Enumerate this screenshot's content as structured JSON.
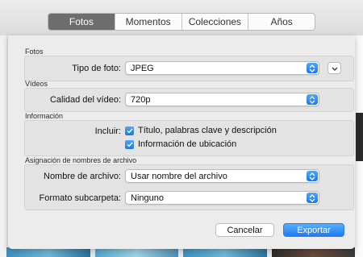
{
  "toolbar": {
    "tabs": [
      {
        "label": "Fotos",
        "active": true
      },
      {
        "label": "Momentos",
        "active": false
      },
      {
        "label": "Colecciones",
        "active": false
      },
      {
        "label": "Años",
        "active": false
      }
    ]
  },
  "dialog": {
    "photos_section": {
      "title": "Fotos",
      "photo_type_label": "Tipo de foto:",
      "photo_type_value": "JPEG"
    },
    "videos_section": {
      "title": "Vídeos",
      "quality_label": "Calidad del vídeo:",
      "quality_value": "720p"
    },
    "info_section": {
      "title": "Información",
      "include_label": "Incluir:",
      "options": [
        {
          "label": "Título, palabras clave y descripción",
          "checked": true
        },
        {
          "label": "Información de ubicación",
          "checked": true
        }
      ]
    },
    "naming_section": {
      "title": "Asignación de nombres de archivo",
      "filename_label": "Nombre de archivo:",
      "filename_value": "Usar nombre del archivo",
      "subfolder_label": "Formato subcarpeta:",
      "subfolder_value": "Ninguno"
    },
    "buttons": {
      "cancel": "Cancelar",
      "export": "Exportar"
    }
  },
  "colors": {
    "accent": "#1e7bf1",
    "tab_active": "#6d6d6d"
  }
}
